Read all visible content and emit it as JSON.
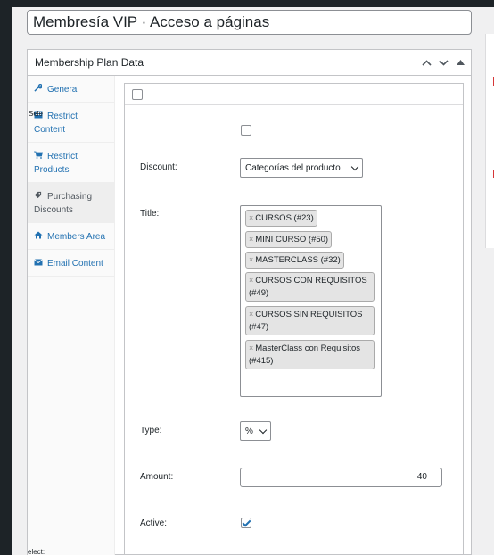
{
  "title_value": "Membresía VIP · Acceso a páginas",
  "box": {
    "title": "Membership Plan Data"
  },
  "tabs": [
    {
      "label": "General",
      "icon": "wrench-icon",
      "active": false
    },
    {
      "label": "Restrict Content",
      "icon": "content-icon",
      "active": false
    },
    {
      "label": "Restrict Products",
      "icon": "cart-icon",
      "active": false
    },
    {
      "label": "Purchasing Discounts",
      "icon": "tag-icon",
      "active": true
    },
    {
      "label": "Members Area",
      "icon": "home-icon",
      "active": false
    },
    {
      "label": "Email Content",
      "icon": "envelope-icon",
      "active": false
    }
  ],
  "stray_texts": [
    "Sele",
    "elect:"
  ],
  "form": {
    "discount_label": "Discount:",
    "discount_value": "Categorías del producto",
    "title_label": "Title:",
    "title_items": [
      {
        "remove": "×",
        "text": "CURSOS (#23)"
      },
      {
        "remove": "×",
        "text": "MINI CURSO (#50)"
      },
      {
        "remove": "×",
        "text": "MASTERCLASS (#32)"
      },
      {
        "remove": "×",
        "text": "CURSOS CON REQUISITOS (#49)"
      },
      {
        "remove": "×",
        "text": "CURSOS SIN REQUISITOS (#47)"
      },
      {
        "remove": "×",
        "text": "MasterClass con Requisitos (#415)"
      }
    ],
    "type_label": "Type:",
    "type_value": "%",
    "amount_label": "Amount:",
    "amount_value": "40",
    "active_label": "Active:",
    "active_checked": true
  },
  "colors": {
    "link": "#2271b1",
    "admin_bar": "#1d2327",
    "accent_red": "#d63638"
  }
}
